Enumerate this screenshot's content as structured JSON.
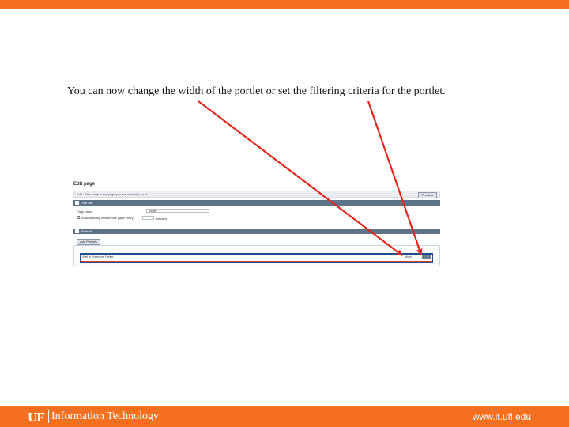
{
  "caption": "You can now change the width of the portlet or set the filtering criteria for the portlet.",
  "screenshot": {
    "title": "Edit page",
    "hint": "Edit - This page is the page you are currently on id",
    "preview_button": "Preview",
    "section1_label": "Title bar",
    "page_name_label": "Page name",
    "page_name_value": "Master",
    "auto_label": "Automatically refresh this page every",
    "auto_suffix": "minutes",
    "section2_label": "Portlets",
    "add_portlets_button": "Add Portlets",
    "portlet_name": "Staff or Enterprise Portlet",
    "portlet_width": "Width"
  },
  "footer": {
    "logo": "UF",
    "unit": "Information Technology",
    "url": "www.it.ufl.edu"
  },
  "colors": {
    "brand_orange": "#f37021",
    "arrow_red": "#e0281c",
    "section_bar": "#5e7288"
  }
}
